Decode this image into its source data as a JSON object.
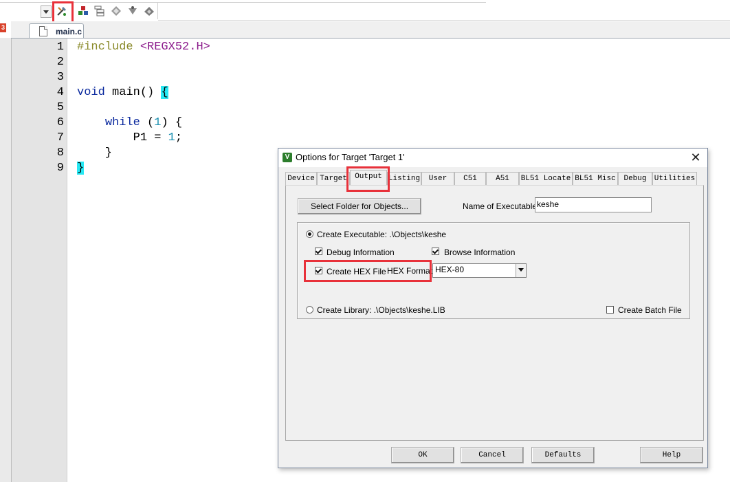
{
  "toolbar": {
    "icons": [
      "dropdown-arrow-icon",
      "options-for-target-icon",
      "manage-components-icon",
      "select-packs-icon",
      "pack-installer-icon",
      "environment-icon",
      "event-icon"
    ],
    "highlight_color": "#e8313a"
  },
  "side_marker": "3",
  "editor": {
    "tab_label": "main.c",
    "line_numbers": [
      "1",
      "2",
      "3",
      "4",
      "5",
      "6",
      "7",
      "8",
      "9"
    ],
    "lines": {
      "l1_directive": "#include",
      "l1_header": "<REGX52.H>",
      "l4_kw": "void",
      "l4_rest": " main() ",
      "l4_brace": "{",
      "l6_indent": "    ",
      "l6_kw": "while",
      "l6_open": " (",
      "l6_num": "1",
      "l6_close": ") {",
      "l7_indent": "        ",
      "l7_var": "P1 = ",
      "l7_num": "1",
      "l7_semi": ";",
      "l8_text": "    }",
      "l9_brace": "}"
    }
  },
  "dialog": {
    "title": "Options for Target 'Target 1'",
    "close_glyph": "✕",
    "logo": "V",
    "tabs": [
      "Device",
      "Target",
      "Output",
      "Listing",
      "User",
      "C51",
      "A51",
      "BL51 Locate",
      "BL51 Misc",
      "Debug",
      "Utilities"
    ],
    "active_tab": "Output",
    "select_folder_button": "Select Folder for Objects...",
    "name_of_executable_label": "Name of Executable:",
    "name_of_executable_value": "keshe",
    "create_executable_label": "Create Executable:  .\\Objects\\keshe",
    "debug_information_label": "Debug Information",
    "browse_information_label": "Browse Information",
    "create_hex_file_label": "Create HEX File",
    "hex_format_label": "HEX Format:",
    "hex_format_value": "HEX-80",
    "create_library_label": "Create Library:  .\\Objects\\keshe.LIB",
    "create_batch_file_label": "Create Batch File",
    "buttons": {
      "ok": "OK",
      "cancel": "Cancel",
      "defaults": "Defaults",
      "help": "Help"
    },
    "state": {
      "create_executable": true,
      "create_library": false,
      "debug_information": true,
      "browse_information": true,
      "create_hex_file": true,
      "create_batch_file": false
    }
  }
}
